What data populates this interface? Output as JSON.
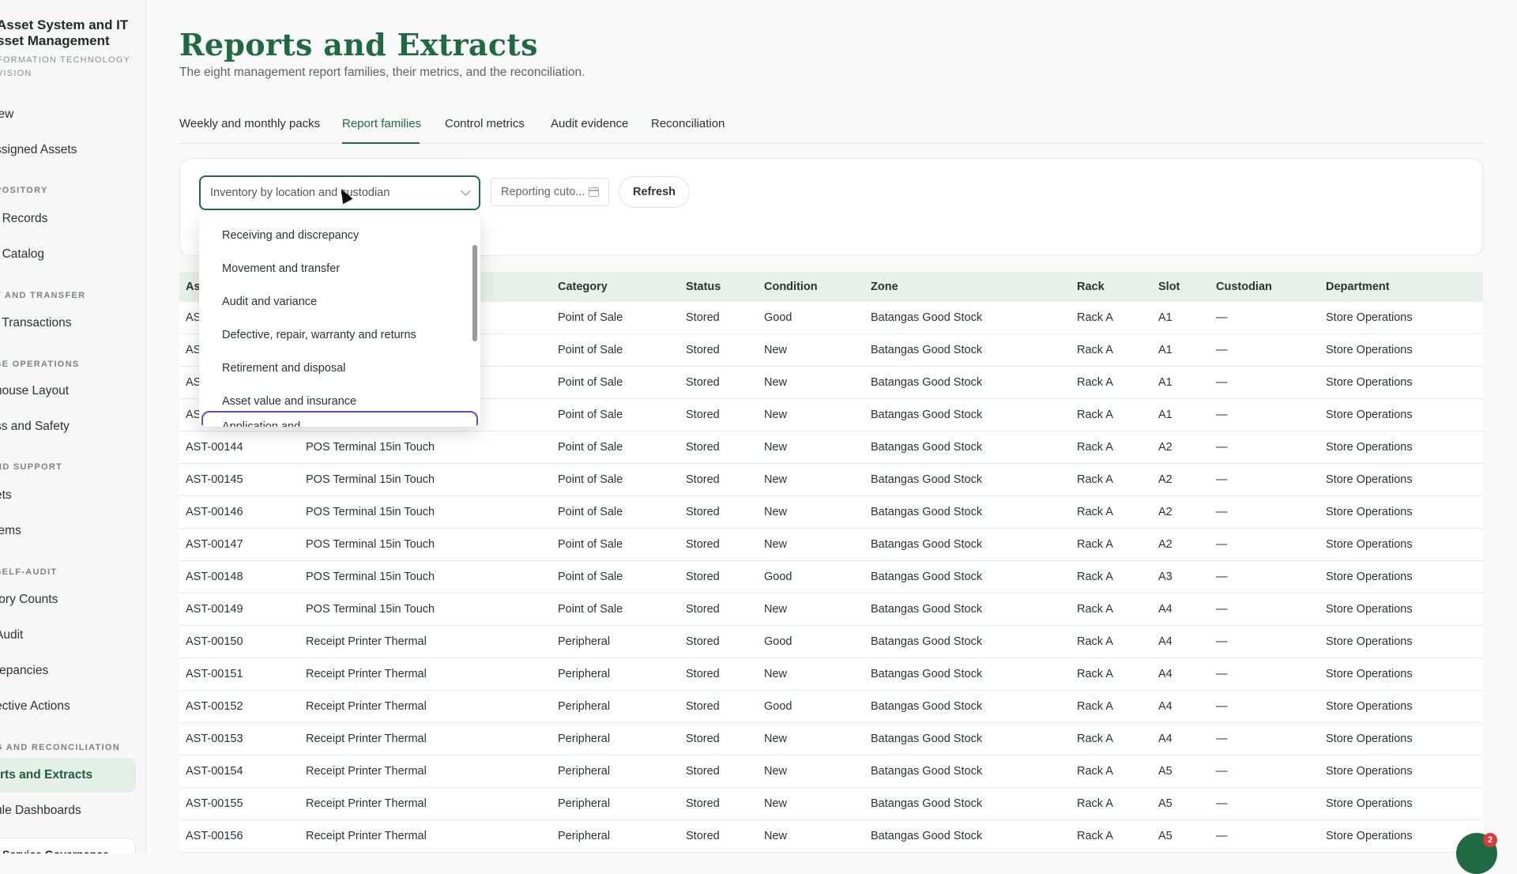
{
  "sidebar": {
    "brand_line1": "Asset System and IT",
    "brand_line2": "sset Management",
    "brand_sub1": "FORMATION TECHNOLOGY",
    "brand_sub2": "VISION",
    "items": [
      {
        "label": "iew",
        "kind": "item"
      },
      {
        "label": "ssigned Assets",
        "kind": "item"
      },
      {
        "label": "POSITORY",
        "kind": "section"
      },
      {
        "label": "t Records",
        "kind": "item"
      },
      {
        "label": "t Catalog",
        "kind": "item"
      },
      {
        "label": "T AND TRANSFER",
        "kind": "section"
      },
      {
        "label": "t Transactions",
        "kind": "item"
      },
      {
        "label": "SE OPERATIONS",
        "kind": "section"
      },
      {
        "label": "house Layout",
        "kind": "item"
      },
      {
        "label": "ss and Safety",
        "kind": "item"
      },
      {
        "label": "ND SUPPORT",
        "kind": "section"
      },
      {
        "label": "ets",
        "kind": "item"
      },
      {
        "label": "lems",
        "kind": "item"
      },
      {
        "label": "SELF-AUDIT",
        "kind": "section"
      },
      {
        "label": "tory Counts",
        "kind": "item"
      },
      {
        "label": "Audit",
        "kind": "item"
      },
      {
        "label": "repancies",
        "kind": "item"
      },
      {
        "label": "ective Actions",
        "kind": "item"
      },
      {
        "label": "G AND RECONCILIATION",
        "kind": "section"
      },
      {
        "label": "rts and Extracts",
        "kind": "active"
      },
      {
        "label": "ule Dashboards",
        "kind": "item"
      }
    ],
    "bottom_label": "Service Governance"
  },
  "page": {
    "title": "Reports and Extracts",
    "subtitle": "The eight management report families, their metrics, and the reconciliation."
  },
  "tabs": [
    {
      "label": "Weekly and monthly packs",
      "active": false
    },
    {
      "label": "Report families",
      "active": true
    },
    {
      "label": "Control metrics",
      "active": false
    },
    {
      "label": "Audit evidence",
      "active": false
    },
    {
      "label": "Reconciliation",
      "active": false
    }
  ],
  "filters": {
    "report_family_value": "Inventory by location and custodian",
    "date_placeholder": "Reporting cuto...",
    "refresh_label": "Refresh"
  },
  "dropdown": {
    "options": [
      "Receiving and discrepancy",
      "Movement and transfer",
      "Audit and variance",
      "Defective, repair, warranty and returns",
      "Retirement and disposal",
      "Asset value and insurance"
    ],
    "partial_option": "Application and ..."
  },
  "table": {
    "columns": [
      "As",
      "",
      "Category",
      "Status",
      "Condition",
      "Zone",
      "Rack",
      "Slot",
      "Custodian",
      "Department"
    ],
    "rows": [
      [
        "AS",
        "",
        "Point of Sale",
        "Stored",
        "Good",
        "Batangas Good Stock",
        "Rack A",
        "A1",
        "—",
        "Store Operations"
      ],
      [
        "AS",
        "",
        "Point of Sale",
        "Stored",
        "New",
        "Batangas Good Stock",
        "Rack A",
        "A1",
        "—",
        "Store Operations"
      ],
      [
        "AS",
        "",
        "Point of Sale",
        "Stored",
        "New",
        "Batangas Good Stock",
        "Rack A",
        "A1",
        "—",
        "Store Operations"
      ],
      [
        "AS",
        "",
        "Point of Sale",
        "Stored",
        "New",
        "Batangas Good Stock",
        "Rack A",
        "A1",
        "—",
        "Store Operations"
      ],
      [
        "AST-00144",
        "POS Terminal 15in Touch",
        "Point of Sale",
        "Stored",
        "New",
        "Batangas Good Stock",
        "Rack A",
        "A2",
        "—",
        "Store Operations"
      ],
      [
        "AST-00145",
        "POS Terminal 15in Touch",
        "Point of Sale",
        "Stored",
        "New",
        "Batangas Good Stock",
        "Rack A",
        "A2",
        "—",
        "Store Operations"
      ],
      [
        "AST-00146",
        "POS Terminal 15in Touch",
        "Point of Sale",
        "Stored",
        "New",
        "Batangas Good Stock",
        "Rack A",
        "A2",
        "—",
        "Store Operations"
      ],
      [
        "AST-00147",
        "POS Terminal 15in Touch",
        "Point of Sale",
        "Stored",
        "New",
        "Batangas Good Stock",
        "Rack A",
        "A2",
        "—",
        "Store Operations"
      ],
      [
        "AST-00148",
        "POS Terminal 15in Touch",
        "Point of Sale",
        "Stored",
        "Good",
        "Batangas Good Stock",
        "Rack A",
        "A3",
        "—",
        "Store Operations"
      ],
      [
        "AST-00149",
        "POS Terminal 15in Touch",
        "Point of Sale",
        "Stored",
        "New",
        "Batangas Good Stock",
        "Rack A",
        "A4",
        "—",
        "Store Operations"
      ],
      [
        "AST-00150",
        "Receipt Printer Thermal",
        "Peripheral",
        "Stored",
        "Good",
        "Batangas Good Stock",
        "Rack A",
        "A4",
        "—",
        "Store Operations"
      ],
      [
        "AST-00151",
        "Receipt Printer Thermal",
        "Peripheral",
        "Stored",
        "New",
        "Batangas Good Stock",
        "Rack A",
        "A4",
        "—",
        "Store Operations"
      ],
      [
        "AST-00152",
        "Receipt Printer Thermal",
        "Peripheral",
        "Stored",
        "Good",
        "Batangas Good Stock",
        "Rack A",
        "A4",
        "—",
        "Store Operations"
      ],
      [
        "AST-00153",
        "Receipt Printer Thermal",
        "Peripheral",
        "Stored",
        "New",
        "Batangas Good Stock",
        "Rack A",
        "A4",
        "—",
        "Store Operations"
      ],
      [
        "AST-00154",
        "Receipt Printer Thermal",
        "Peripheral",
        "Stored",
        "New",
        "Batangas Good Stock",
        "Rack A",
        "A5",
        "—",
        "Store Operations"
      ],
      [
        "AST-00155",
        "Receipt Printer Thermal",
        "Peripheral",
        "Stored",
        "New",
        "Batangas Good Stock",
        "Rack A",
        "A5",
        "—",
        "Store Operations"
      ],
      [
        "AST-00156",
        "Receipt Printer Thermal",
        "Peripheral",
        "Stored",
        "New",
        "Batangas Good Stock",
        "Rack A",
        "A5",
        "—",
        "Store Operations"
      ]
    ]
  },
  "chat": {
    "badge": "2"
  },
  "colors": {
    "accent": "#1f6a43",
    "focus": "#5b4bd0",
    "header_bg": "#e7f0ea"
  }
}
